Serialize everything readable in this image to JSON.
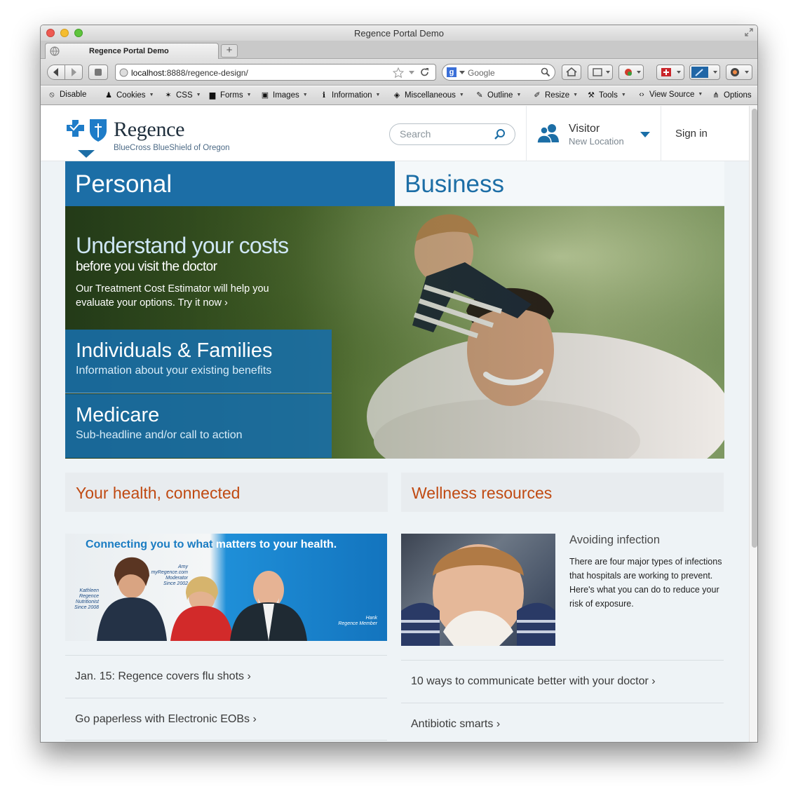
{
  "window": {
    "title": "Regence Portal Demo"
  },
  "tab": {
    "label": "Regence Portal Demo",
    "new_tab": "+"
  },
  "navbar": {
    "url_host": "localhost",
    "url_path": ":8888/regence-design/",
    "search_engine_placeholder": "Google"
  },
  "devbar": {
    "items": [
      "Disable",
      "Cookies",
      "CSS",
      "Forms",
      "Images",
      "Information",
      "Miscellaneous",
      "Outline",
      "Resize",
      "Tools",
      "View Source",
      "Options"
    ]
  },
  "site": {
    "brand_name": "Regence",
    "brand_tagline": "BlueCross BlueShield of Oregon",
    "search_placeholder": "Search",
    "visitor_label": "Visitor",
    "visitor_sub": "New Location",
    "signin": "Sign in",
    "tabs": {
      "personal": "Personal",
      "business": "Business"
    },
    "hero": {
      "headline": "Understand your costs",
      "subheadline": "before you visit the doctor",
      "body": "Our Treatment Cost Estimator will help you evaluate your options. Try it now ›"
    },
    "promos": [
      {
        "title": "Individuals & Families",
        "subtitle": "Information about your existing benefits"
      },
      {
        "title": "Medicare",
        "subtitle": "Sub-headline and/or call to action"
      }
    ],
    "left_section": {
      "heading": "Your health, connected",
      "banner_title_a": "Connecting you to what",
      "banner_title_b": " matters to your health.",
      "captions": {
        "kathleen": "Kathleen\nRegence\nNutritionist\nSince 2008",
        "amy": "Amy\nmyRegence.com\nModerator\nSince 2002",
        "hank": "Hank\nRegence Member"
      },
      "links": [
        "Jan. 15: Regence covers flu shots ›",
        "Go paperless with Electronic EOBs ›"
      ]
    },
    "right_section": {
      "heading": "Wellness resources",
      "article_title": "Avoiding infection",
      "article_body": "There are four major types of infections that hospitals are working to prevent. Here's what you can do to reduce your risk of exposure.",
      "links": [
        "10 ways to communicate better with your doctor ›",
        "Antibiotic smarts ›"
      ]
    }
  },
  "colors": {
    "brand_blue": "#1c6ea6",
    "accent_orange": "#c04a12"
  }
}
